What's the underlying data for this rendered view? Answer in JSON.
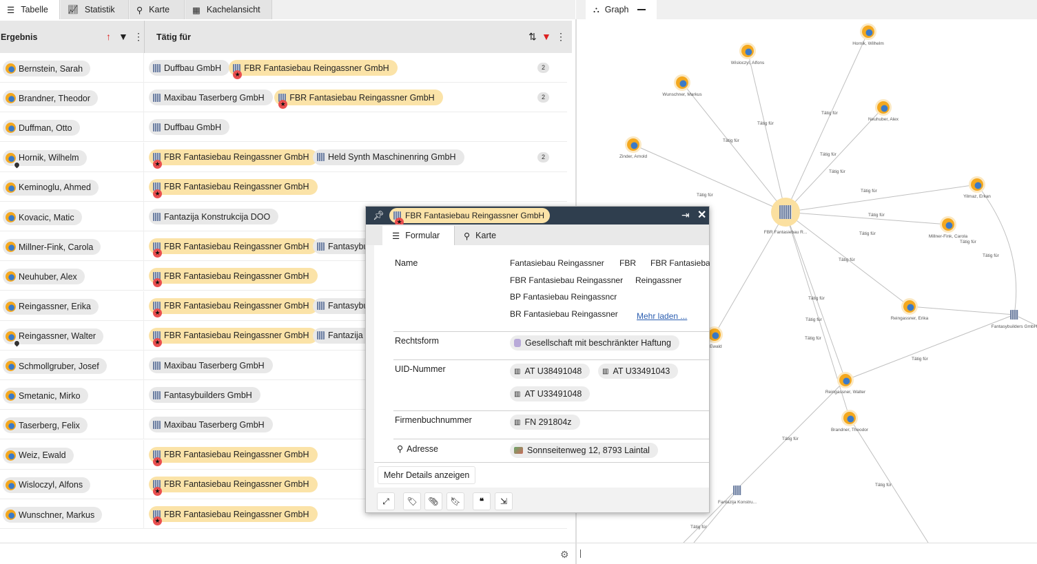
{
  "tabs": {
    "table": "Tabelle",
    "stats": "Statistik",
    "map": "Karte",
    "tiles": "Kachelansicht",
    "graph": "Graph"
  },
  "table": {
    "col_result": "Ergebnis",
    "col_works_for": "Tätig für",
    "rows": [
      {
        "name": "Bernstein, Sarah",
        "chips": [
          {
            "label": "Duffbau GmbH",
            "fbr": false
          },
          {
            "label": "FBR Fantasiebau Reingassner GmbH",
            "fbr": true
          }
        ],
        "count": "2"
      },
      {
        "name": "Brandner, Theodor",
        "chips": [
          {
            "label": "Maxibau Taserberg GmbH",
            "fbr": false
          },
          {
            "label": "FBR Fantasiebau Reingassner GmbH",
            "fbr": true
          }
        ],
        "count": "2"
      },
      {
        "name": "Duffman, Otto",
        "chips": [
          {
            "label": "Duffbau GmbH",
            "fbr": false
          }
        ],
        "count": ""
      },
      {
        "name": "Hornik, Wilhelm",
        "chips": [
          {
            "label": "FBR Fantasiebau Reingassner GmbH",
            "fbr": true
          },
          {
            "label": "Held Synth Maschinenring GmbH",
            "fbr": false
          }
        ],
        "count": "2"
      },
      {
        "name": "Keminoglu, Ahmed",
        "chips": [
          {
            "label": "FBR Fantasiebau Reingassner GmbH",
            "fbr": true
          }
        ],
        "count": ""
      },
      {
        "name": "Kovacic, Matic",
        "chips": [
          {
            "label": "Fantazija Konstrukcija DOO",
            "fbr": false
          }
        ],
        "count": ""
      },
      {
        "name": "Millner-Fink, Carola",
        "chips": [
          {
            "label": "FBR Fantasiebau Reingassner GmbH",
            "fbr": true
          },
          {
            "label": "Fantasybu",
            "fbr": false
          }
        ],
        "count": ""
      },
      {
        "name": "Neuhuber, Alex",
        "chips": [
          {
            "label": "FBR Fantasiebau Reingassner GmbH",
            "fbr": true
          }
        ],
        "count": ""
      },
      {
        "name": "Reingassner, Erika",
        "chips": [
          {
            "label": "FBR Fantasiebau Reingassner GmbH",
            "fbr": true
          },
          {
            "label": "Fantasybu",
            "fbr": false
          }
        ],
        "count": ""
      },
      {
        "name": "Reingassner, Walter",
        "chips": [
          {
            "label": "FBR Fantasiebau Reingassner GmbH",
            "fbr": true
          },
          {
            "label": "Fantazija K",
            "fbr": false
          }
        ],
        "count": ""
      },
      {
        "name": "Schmollgruber, Josef",
        "chips": [
          {
            "label": "Maxibau Taserberg GmbH",
            "fbr": false
          }
        ],
        "count": ""
      },
      {
        "name": "Smetanic, Mirko",
        "chips": [
          {
            "label": "Fantasybuilders GmbH",
            "fbr": false
          }
        ],
        "count": ""
      },
      {
        "name": "Taserberg, Felix",
        "chips": [
          {
            "label": "Maxibau Taserberg GmbH",
            "fbr": false
          }
        ],
        "count": ""
      },
      {
        "name": "Weiz, Ewald",
        "chips": [
          {
            "label": "FBR Fantasiebau Reingassner GmbH",
            "fbr": true
          }
        ],
        "count": ""
      },
      {
        "name": "Wisloczyl, Alfons",
        "chips": [
          {
            "label": "FBR Fantasiebau Reingassner GmbH",
            "fbr": true
          }
        ],
        "count": ""
      },
      {
        "name": "Wunschner, Markus",
        "chips": [
          {
            "label": "FBR Fantasiebau Reingassner GmbH",
            "fbr": true
          }
        ],
        "count": ""
      }
    ]
  },
  "graph": {
    "center_label": "FBR Fantasiebau R...",
    "edge_label": "Tätig für",
    "nodes": [
      {
        "label": "Hornik, Wilhelm",
        "type": "person"
      },
      {
        "label": "Wisloczyl, Alfons",
        "type": "person"
      },
      {
        "label": "Wunschner, Markus",
        "type": "person"
      },
      {
        "label": "Neuhuber, Alex",
        "type": "person"
      },
      {
        "label": "Zinder, Arnold",
        "type": "person"
      },
      {
        "label": "Yilmaz, Erkan",
        "type": "person"
      },
      {
        "label": "Millner-Fink, Carola",
        "type": "person"
      },
      {
        "label": "Reingassner, Erika",
        "type": "person"
      },
      {
        "label": "Fantasybuilders GmbH",
        "type": "company"
      },
      {
        "label": ", Ewald",
        "type": "person"
      },
      {
        "label": "Reingassner, Walter",
        "type": "person"
      },
      {
        "label": "Brandner, Theodor",
        "type": "person"
      },
      {
        "label": "Fantazija Konstru...",
        "type": "company"
      }
    ]
  },
  "popup": {
    "title": "FBR Fantasiebau Reingassner GmbH",
    "tab_form": "Formular",
    "tab_map": "Karte",
    "name_label": "Name",
    "names": [
      "Fantasiebau Reingassner",
      "FBR",
      "FBR Fantasiebau",
      "FBR Fantasiebau Reingassner",
      "Reingassner",
      "BP Fantasiebau Reingassncr",
      "BR Fantasiebau Reingassner"
    ],
    "load_more": "Mehr laden ...",
    "legal_form_label": "Rechtsform",
    "legal_form": "Gesellschaft mit beschränkter Haftung",
    "uid_label": "UID-Nummer",
    "uids": [
      "AT U38491048",
      "AT U33491043",
      "AT U33491048"
    ],
    "register_label": "Firmenbuchnummer",
    "register": "FN 291804z",
    "address_label": "Adresse",
    "address": "Sonnseitenweg 12, 8793 Laintal",
    "more_details": "Mehr Details anzeigen"
  }
}
